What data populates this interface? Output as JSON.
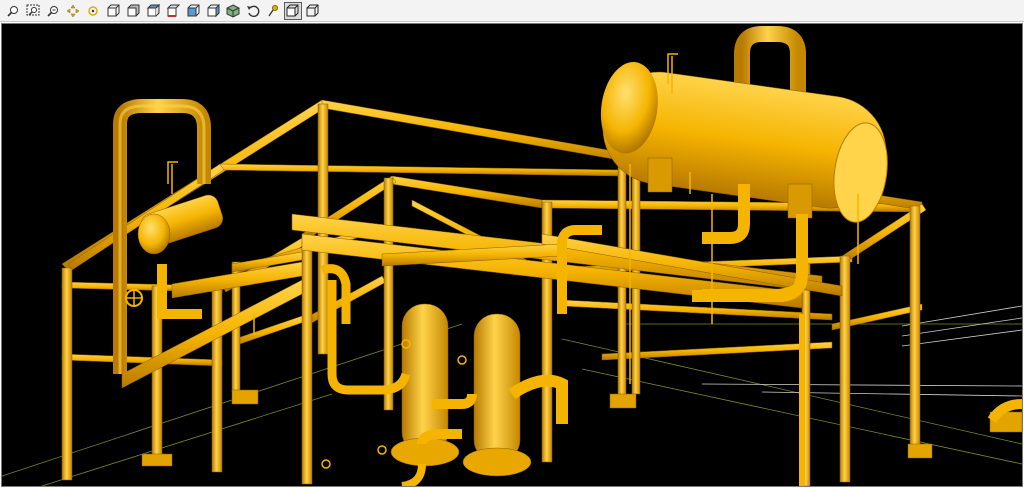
{
  "toolbar": {
    "buttons": [
      {
        "icon": "zoom-icon"
      },
      {
        "icon": "zoom-window-icon"
      },
      {
        "icon": "zoom-extents-icon"
      },
      {
        "icon": "pan-icon"
      },
      {
        "icon": "rotate-center-icon"
      },
      {
        "icon": "view-front-icon"
      },
      {
        "icon": "view-back-icon"
      },
      {
        "icon": "view-top-icon"
      },
      {
        "icon": "view-bottom-icon"
      },
      {
        "icon": "view-left-icon"
      },
      {
        "icon": "view-right-icon"
      },
      {
        "icon": "view-iso-icon"
      },
      {
        "icon": "undo-view-icon"
      },
      {
        "icon": "redo-view-icon"
      },
      {
        "icon": "shaded-mode-icon",
        "active": true
      },
      {
        "icon": "wireframe-mode-icon"
      }
    ]
  },
  "viewport": {
    "background": "#000000",
    "model_color": "#F5B400",
    "model_highlight": "#FFD34A",
    "model_shadow": "#B87A00",
    "grid_color": "#7A8A2A"
  }
}
